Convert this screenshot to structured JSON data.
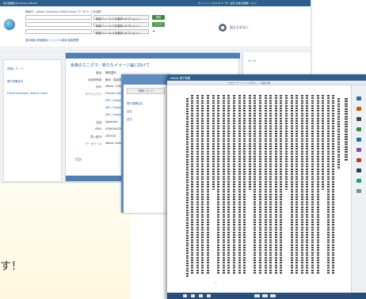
{
  "back_window": {
    "topbar_left": "電子図書館 Dictionary eBooks",
    "topbar_right": "サインイン  フォルダ  ユーザー設定  言語  新機能  ヘルプ",
    "search_label": "検索中 - eBook Collection (EBSCOhost)  データベースを選択",
    "field_option": "検索フィールドを選択 (オプション)",
    "search_button": "検索",
    "clear_button": "クリア",
    "add_row": "+",
    "links": "基本検索  詳細検索  ビジュアル検索  検索履歴",
    "univ_name": "国立大学法人",
    "left_items": [
      "詳細レコード",
      "電子書籍全文",
      "Find It Electronic Article Linker"
    ],
    "center_title": "肖像のエニグマ：新たなイメージ論に向けて",
    "fields": [
      {
        "k": "著者:",
        "v": "岡田温司"
      },
      {
        "k": "出版物情報:",
        "v": "東京 : 岩波書店, 2008."
      },
      {
        "k": "資料:",
        "v": "eBook, 316p."
      },
      {
        "k": "サブジェクト:",
        "v": "Portrait drawing / Portraits painting / Portraits"
      },
      {
        "k": "",
        "v": "ART / Subjects & Themes"
      },
      {
        "k": "",
        "v": "ART / Subjects & Themes"
      },
      {
        "k": "",
        "v": "ART / Subjects & Themes"
      },
      {
        "k": "言語:",
        "v": "Japanese"
      },
      {
        "k": "ISBN:",
        "v": "9784000226088"
      },
      {
        "k": "受入番号:",
        "v": "258726"
      },
      {
        "k": "データベース:",
        "v": "eBook Collection (EBSCOhost)"
      }
    ],
    "toc_label": "目次",
    "right_label": "ツール"
  },
  "middle_panel": {
    "button": "詳細レコード",
    "links": [
      "電子書籍全文",
      "全文",
      "目次"
    ]
  },
  "front_viewer": {
    "topbar": "eBook 電子書籍",
    "page_header": "プロローグ  イメージの行へ --- 肖像の謎",
    "page_number": "1"
  },
  "caption": "す！"
}
